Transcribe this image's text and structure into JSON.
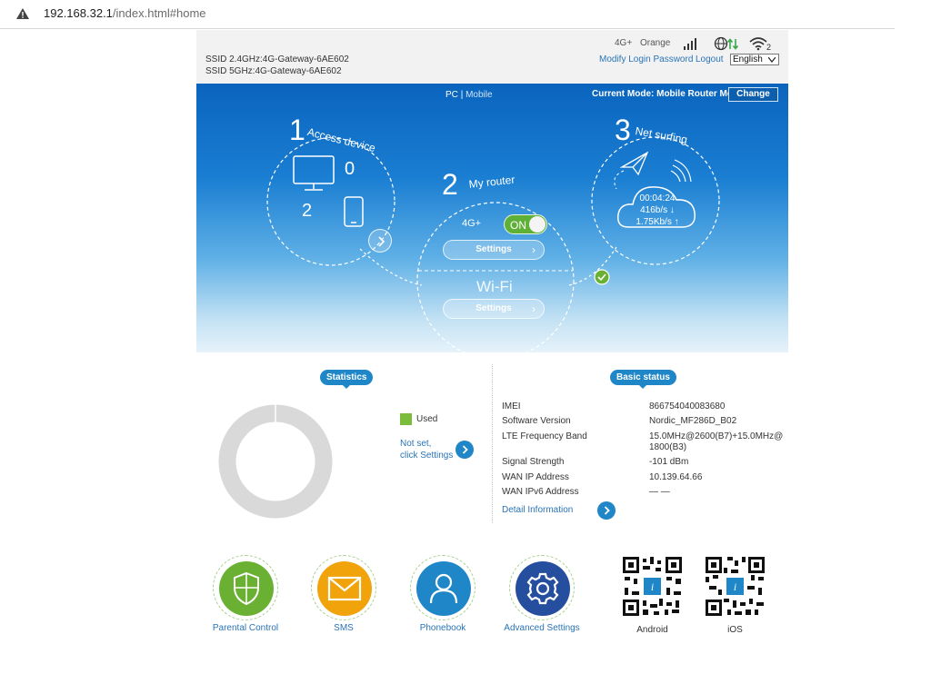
{
  "browser": {
    "url_host": "192.168.32.1",
    "url_path": "/index.html#home"
  },
  "header": {
    "ssid_24": "SSID 2.4GHz:4G-Gateway-6AE602",
    "ssid_5": "SSID 5GHz:4G-Gateway-6AE602",
    "network_type": "4G+",
    "carrier": "Orange",
    "wifi_clients": "2",
    "modify_password": "Modify Login Password",
    "logout": "Logout",
    "language": "English"
  },
  "banner": {
    "pc": "PC",
    "separator": "|",
    "mobile": "Mobile",
    "current_mode": "Current Mode: Mobile Router Mode",
    "change": "Change",
    "step1_num": "1",
    "step1_title": "Access device",
    "pc_count": "0",
    "phone_count": "2",
    "step2_num": "2",
    "step2_title": "My router",
    "network_label": "4G+",
    "toggle_label": "ON",
    "settings_label": "Settings",
    "wifi_title": "Wi-Fi",
    "step3_num": "3",
    "step3_title": "Net surfing",
    "duration": "00:04:24",
    "down_speed": "416b/s ↓",
    "up_speed": "1.75Kb/s ↑"
  },
  "statistics": {
    "title": "Statistics",
    "legend_used": "Used",
    "not_set_line1": "Not set,",
    "not_set_line2": "click Settings"
  },
  "basic_status": {
    "title": "Basic status",
    "rows": [
      {
        "label": "IMEI",
        "value": "866754040083680"
      },
      {
        "label": "Software Version",
        "value": "Nordic_MF286D_B02"
      },
      {
        "label": "LTE Frequency Band",
        "value": "15.0MHz@2600(B7)+15.0MHz@",
        "value2": "1800(B3)"
      },
      {
        "label": "Signal Strength",
        "value": "-101 dBm"
      },
      {
        "label": "WAN IP Address",
        "value": "10.139.64.66"
      },
      {
        "label": "WAN IPv6 Address",
        "value": "— —"
      }
    ],
    "detail_link": "Detail Information"
  },
  "apps": [
    {
      "label": "Parental Control",
      "color": "#6ab033"
    },
    {
      "label": "SMS",
      "color": "#f0a30a"
    },
    {
      "label": "Phonebook",
      "color": "#1f86c8"
    },
    {
      "label": "Advanced Settings",
      "color": "#254f9e"
    }
  ],
  "qrcodes": [
    {
      "label": "Android"
    },
    {
      "label": "iOS"
    }
  ],
  "colors": {
    "accent": "#1f86c8",
    "used": "#7bbd3a",
    "toggle_on": "#5fb036"
  }
}
